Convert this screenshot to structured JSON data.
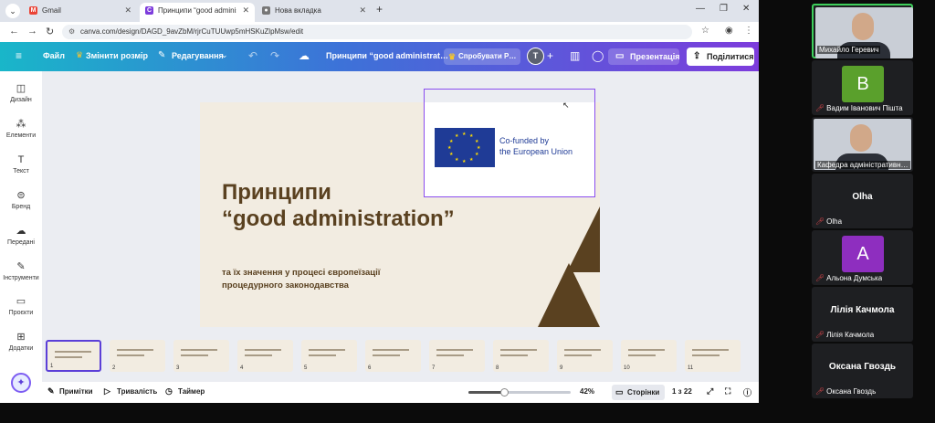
{
  "browser": {
    "tabs": [
      {
        "title": "Gmail",
        "favicon": "gmail-icon",
        "color": "#ea4335"
      },
      {
        "title": "Принципи “good administrati…",
        "favicon": "canva-icon",
        "color": "#7d3cdc"
      },
      {
        "title": "Нова вкладка",
        "favicon": "globe-icon",
        "color": "#777777"
      }
    ],
    "url": "canva.com/design/DAGD_9avZbM/rjrCuTUUwp5mHSKuZlpMsw/edit"
  },
  "toolbar": {
    "file": "Файл",
    "resize": "Змінити розмір",
    "editing": "Редагування",
    "doc_title": "Принципи “good administrat…",
    "try": "Спробувати Р…",
    "avatar_letter": "T",
    "present": "Презентація",
    "share": "Поділитися"
  },
  "sidebar": {
    "items": [
      {
        "label": "Дизайн",
        "icon": "layout-icon"
      },
      {
        "label": "Елементи",
        "icon": "shapes-icon"
      },
      {
        "label": "Текст",
        "icon": "text-icon"
      },
      {
        "label": "Бренд",
        "icon": "brand-icon"
      },
      {
        "label": "Передані",
        "icon": "upload-icon"
      },
      {
        "label": "Інструменти",
        "icon": "draw-icon"
      },
      {
        "label": "Проєкти",
        "icon": "folder-icon"
      },
      {
        "label": "Додатки",
        "icon": "apps-icon"
      }
    ]
  },
  "slide": {
    "title_line1": "Принципи",
    "title_line2": "“good administration”",
    "subtitle_line1": "та їх значення у процесі європеїзації",
    "subtitle_line2": "процедурного законодавства",
    "logo_line1": "Co-funded by",
    "logo_line2": "the European Union",
    "accent": "#5a4120",
    "background": "#f2ece1"
  },
  "thumbnails": [
    1,
    2,
    3,
    4,
    5,
    6,
    7,
    8,
    9,
    10,
    11
  ],
  "bottombar": {
    "notes": "Примітки",
    "duration": "Тривалість",
    "timer": "Таймер",
    "zoom": "42%",
    "zoom_fraction": 0.35,
    "pages": "Сторінки",
    "page_count": "1 з 22"
  },
  "participants": [
    {
      "name": "Михайло Геревич",
      "type": "video",
      "muted": false,
      "speaking": true
    },
    {
      "name": "Вадим Іванович Пішта",
      "type": "avatar",
      "letter": "В",
      "color": "#5aa02c",
      "muted": true
    },
    {
      "name": "Кафедра адміністративн…",
      "type": "video",
      "muted": false
    },
    {
      "name": "Olha",
      "type": "name",
      "big": "Olha",
      "muted": true
    },
    {
      "name": "Альона Думська",
      "type": "avatar",
      "letter": "А",
      "color": "#8e2ebf",
      "muted": true
    },
    {
      "name": "Лілія Качмола",
      "type": "name",
      "big": "Лілія Качмола",
      "muted": true
    },
    {
      "name": "Оксана Гвоздь",
      "type": "name",
      "big": "Оксана Гвоздь",
      "muted": true
    }
  ]
}
